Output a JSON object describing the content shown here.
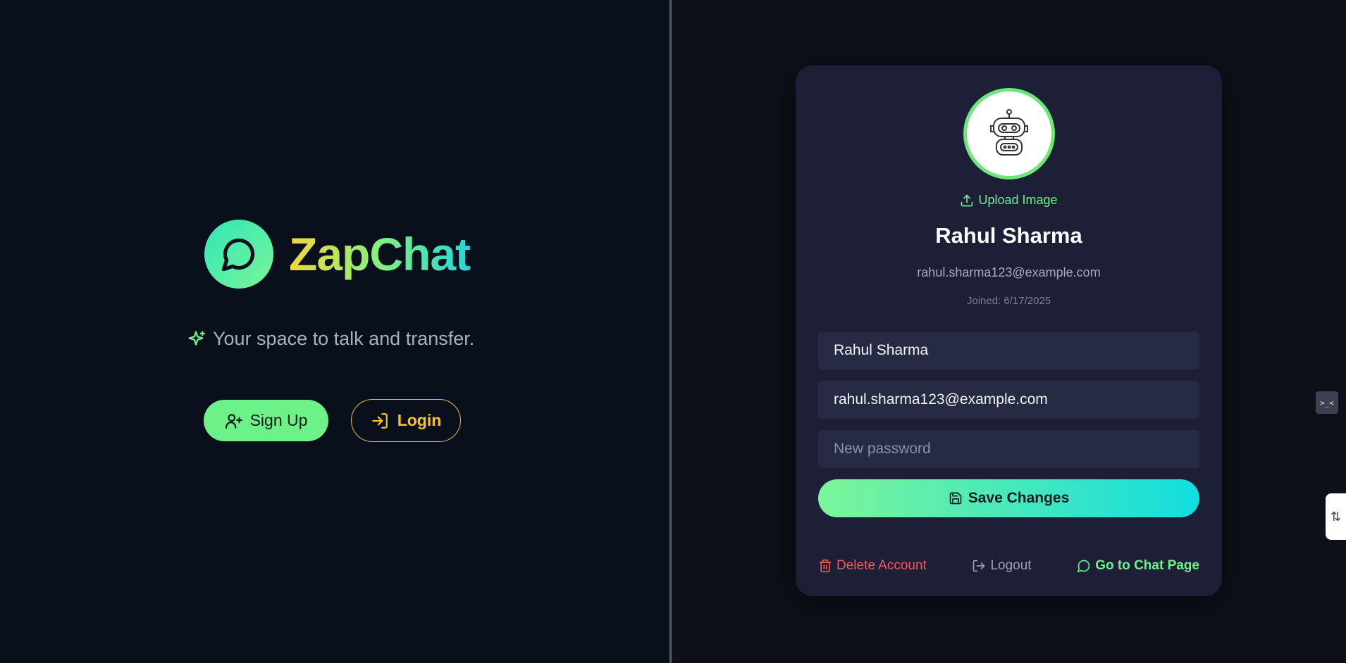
{
  "brand": {
    "name": "ZapChat",
    "icon": "chat-bubble-icon"
  },
  "landing": {
    "tagline": "Your space to talk and transfer.",
    "tagline_icon": "sparkles-icon",
    "signup_label": "Sign Up",
    "login_label": "Login"
  },
  "profile": {
    "avatar_icon": "robot-icon",
    "upload_label": "Upload Image",
    "name": "Rahul Sharma",
    "email": "rahul.sharma123@example.com",
    "joined": "Joined: 6/17/2025"
  },
  "form": {
    "name_value": "Rahul Sharma",
    "email_value": "rahul.sharma123@example.com",
    "password_value": "",
    "password_placeholder": "New password",
    "save_label": "Save Changes"
  },
  "actions": {
    "delete_label": "Delete Account",
    "logout_label": "Logout",
    "chat_label": "Go to Chat Page"
  },
  "colors": {
    "accent_green": "#6df28a",
    "accent_yellow": "#f2c524",
    "danger_red": "#f25a5a",
    "card_bg": "#1c1f35"
  }
}
